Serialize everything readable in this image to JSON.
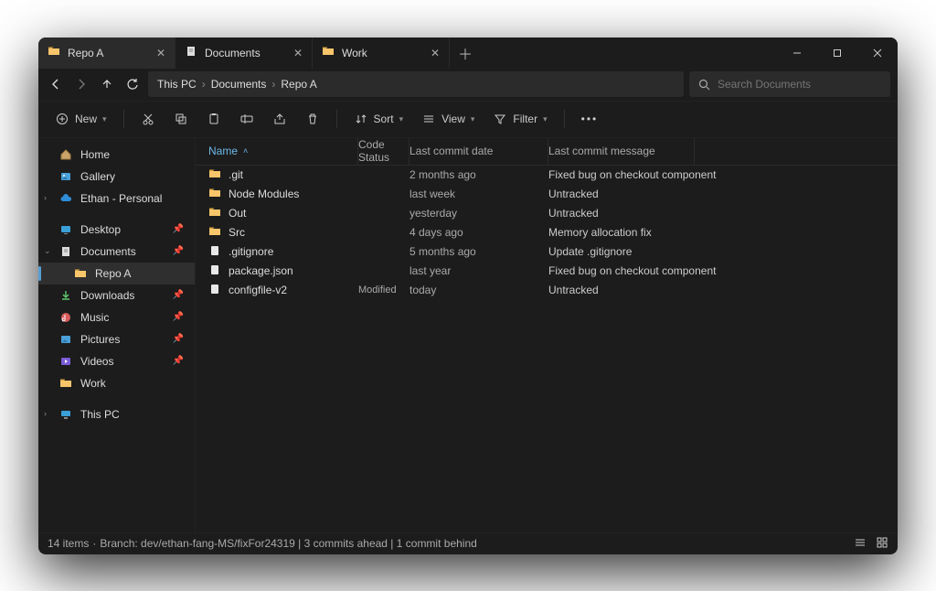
{
  "tabs": [
    {
      "label": "Repo A",
      "icon": "folder",
      "active": true
    },
    {
      "label": "Documents",
      "icon": "document",
      "active": false
    },
    {
      "label": "Work",
      "icon": "folder",
      "active": false
    }
  ],
  "nav": {
    "crumbs": [
      "This PC",
      "Documents",
      "Repo A"
    ]
  },
  "search": {
    "placeholder": "Search Documents"
  },
  "toolbar": {
    "new": "New",
    "sort": "Sort",
    "view": "View",
    "filter": "Filter"
  },
  "sidebar": {
    "home": "Home",
    "gallery": "Gallery",
    "onedrive": "Ethan - Personal",
    "desktop": "Desktop",
    "documents": "Documents",
    "repoA": "Repo A",
    "downloads": "Downloads",
    "music": "Music",
    "pictures": "Pictures",
    "videos": "Videos",
    "work": "Work",
    "thispc": "This PC"
  },
  "columns": {
    "name": "Name",
    "status": "Code Status",
    "date": "Last commit date",
    "msg": "Last commit message"
  },
  "rows": [
    {
      "icon": "folder",
      "name": ".git",
      "status": "",
      "date": "2 months ago",
      "msg": "Fixed bug on checkout component"
    },
    {
      "icon": "folder",
      "name": "Node Modules",
      "status": "",
      "date": "last week",
      "msg": "Untracked"
    },
    {
      "icon": "folder",
      "name": "Out",
      "status": "",
      "date": "yesterday",
      "msg": "Untracked"
    },
    {
      "icon": "folder",
      "name": "Src",
      "status": "",
      "date": "4 days ago",
      "msg": "Memory allocation fix"
    },
    {
      "icon": "file",
      "name": ".gitignore",
      "status": "",
      "date": "5 months ago",
      "msg": "Update .gitignore"
    },
    {
      "icon": "file",
      "name": "package.json",
      "status": "",
      "date": "last year",
      "msg": "Fixed bug on checkout component"
    },
    {
      "icon": "file",
      "name": "configfile-v2",
      "status": "Modified",
      "date": "today",
      "msg": "Untracked"
    }
  ],
  "status": {
    "count": "14 items",
    "branch": "Branch: dev/ethan-fang-MS/fixFor24319 | 3 commits ahead | 1 commit behind"
  }
}
